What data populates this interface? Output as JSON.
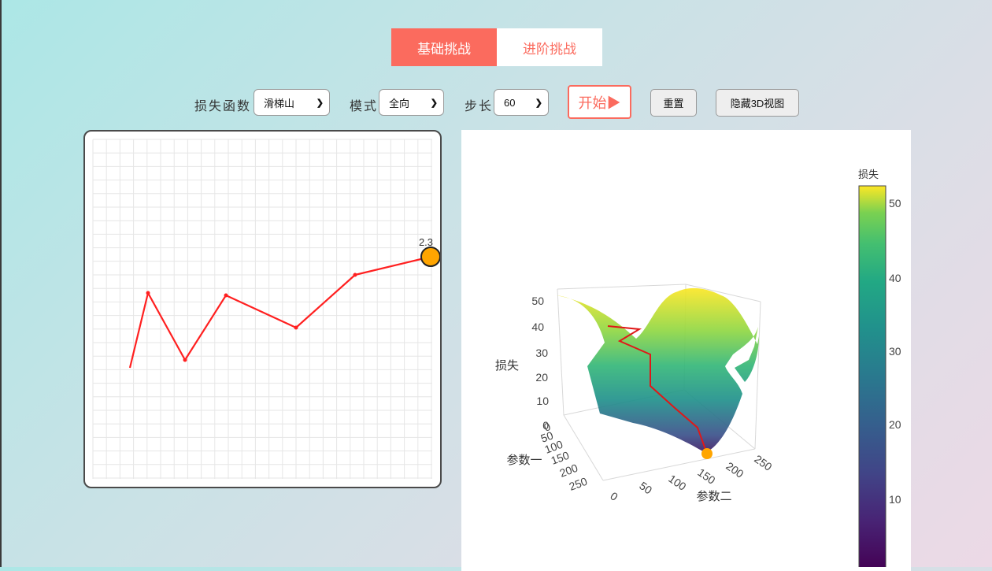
{
  "tabs": [
    {
      "label": "基础挑战",
      "active": true
    },
    {
      "label": "进阶挑战",
      "active": false
    }
  ],
  "controls": {
    "loss_label": "损失函数",
    "loss_value": "滑梯山",
    "mode_label": "模式",
    "mode_value": "全向",
    "step_label": "步长",
    "step_value": "60",
    "start_button": "开始▶",
    "reset_button": "重置",
    "hide3d_button": "隐藏3D视图"
  },
  "colors": {
    "accent": "#fb6b5e",
    "path": "#ff2020",
    "ball": "#ffa500"
  },
  "plot2d": {
    "ball_label": "2.3"
  },
  "plot3d": {
    "z_axis_title": "损失",
    "x_axis_title": "参数一",
    "y_axis_title": "参数二",
    "z_ticks": [
      "50",
      "40",
      "30",
      "20",
      "10",
      "0"
    ],
    "x_ticks": [
      "0",
      "50",
      "100",
      "150",
      "200",
      "250"
    ],
    "y_ticks": [
      "0",
      "50",
      "100",
      "150",
      "200",
      "250"
    ],
    "colorbar_title": "损失",
    "colorbar_ticks": [
      "50",
      "40",
      "30",
      "20",
      "10"
    ]
  }
}
